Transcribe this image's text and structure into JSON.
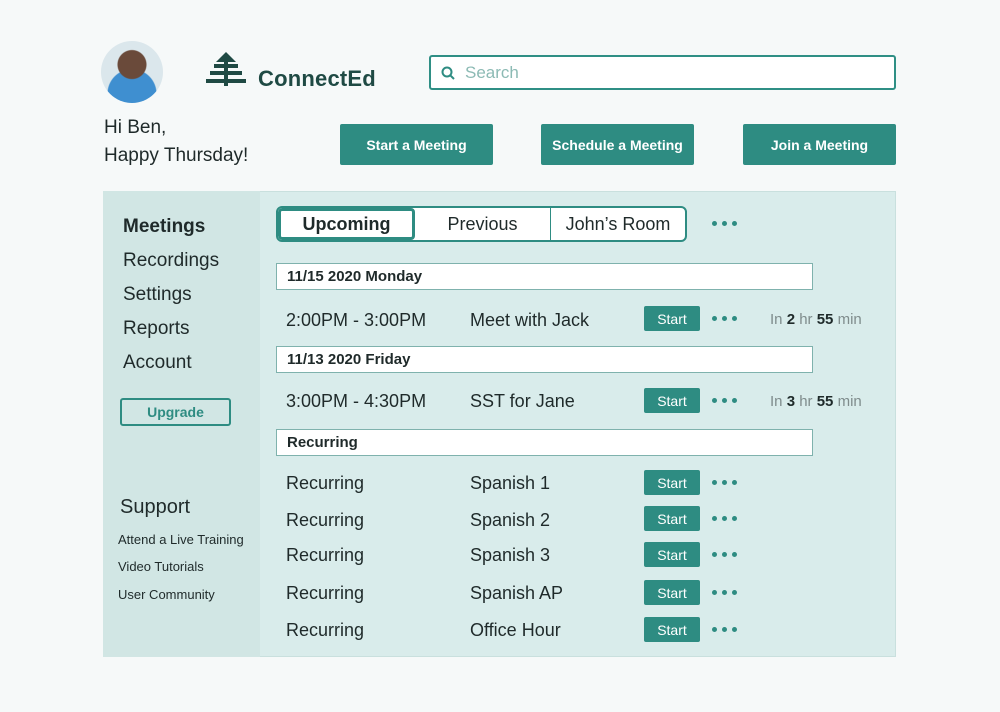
{
  "brand": {
    "name": "ConnectEd"
  },
  "greeting": {
    "line1": "Hi Ben,",
    "line2": "Happy Thursday!"
  },
  "search": {
    "placeholder": "Search"
  },
  "actions": {
    "start": "Start a Meeting",
    "schedule": "Schedule a Meeting",
    "join": "Join a Meeting"
  },
  "sidebar": {
    "items": [
      "Meetings",
      "Recordings",
      "Settings",
      "Reports",
      "Account"
    ],
    "upgrade": "Upgrade",
    "support_title": "Support",
    "support_links": [
      "Attend a Live Training",
      "Video Tutorials",
      "User Community"
    ]
  },
  "tabs": [
    "Upcoming",
    "Previous",
    "John’s Room"
  ],
  "sections": {
    "s1": "11/15 2020 Monday",
    "s2": "11/13 2020 Friday",
    "s3": "Recurring"
  },
  "meetings": [
    {
      "time": "2:00PM - 3:00PM",
      "title": "Meet with Jack",
      "start": "Start",
      "eta": {
        "prefix": "In",
        "hr": "2",
        "hr_label": "hr",
        "min": "55",
        "min_label": "min"
      }
    },
    {
      "time": "3:00PM - 4:30PM",
      "title": "SST for Jane",
      "start": "Start",
      "eta": {
        "prefix": "In",
        "hr": "3",
        "hr_label": "hr",
        "min": "55",
        "min_label": "min"
      }
    }
  ],
  "recurring": [
    {
      "time": "Recurring",
      "title": "Spanish 1",
      "start": "Start"
    },
    {
      "time": "Recurring",
      "title": "Spanish 2",
      "start": "Start"
    },
    {
      "time": "Recurring",
      "title": "Spanish 3",
      "start": "Start"
    },
    {
      "time": "Recurring",
      "title": "Spanish AP",
      "start": "Start"
    },
    {
      "time": "Recurring",
      "title": "Office Hour",
      "start": "Start"
    }
  ],
  "colors": {
    "accent": "#2e8c82",
    "panel": "#d9eceb",
    "sidebar": "#d1e6e4"
  },
  "icons": {
    "search": "search-icon",
    "logo": "pine-tree-icon",
    "more": "more-dots-icon"
  }
}
